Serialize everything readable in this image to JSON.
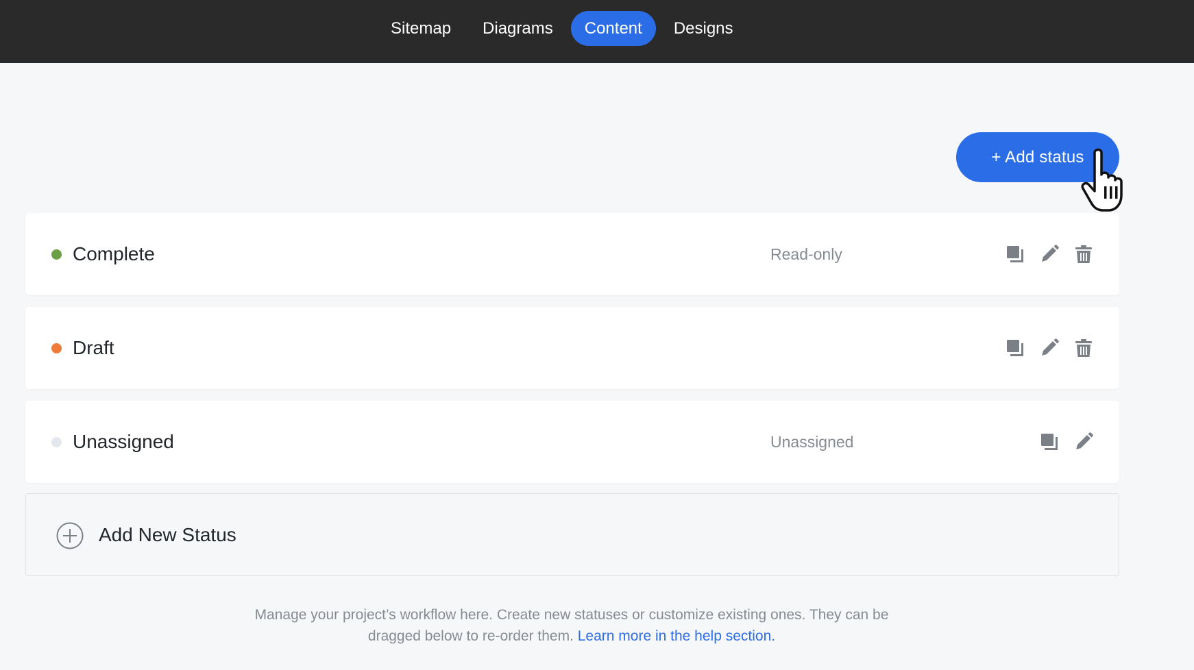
{
  "nav": {
    "tabs": [
      {
        "label": "Sitemap"
      },
      {
        "label": "Diagrams"
      },
      {
        "label": "Content"
      },
      {
        "label": "Designs"
      }
    ],
    "active_tab": "Content"
  },
  "toolbar": {
    "add_status_label": "+ Add status"
  },
  "statuses": [
    {
      "name": "Complete",
      "meta": "Read-only",
      "dot_color": "#6a9f45",
      "actions": [
        "duplicate-icon",
        "edit-icon",
        "delete-icon"
      ]
    },
    {
      "name": "Draft",
      "meta": "",
      "dot_color": "#f07a3a",
      "actions": [
        "duplicate-icon",
        "edit-icon",
        "delete-icon"
      ]
    },
    {
      "name": "Unassigned",
      "meta": "Unassigned",
      "dot_color": "#e3e7ee",
      "actions": [
        "duplicate-icon",
        "edit-icon"
      ]
    }
  ],
  "add_new": {
    "label": "Add New Status",
    "icon": "plus-circle-icon"
  },
  "help": {
    "line1": "Manage your project’s workflow here. Create new statuses or customize existing ones. They can be",
    "line2": "dragged below to re-order them.",
    "link": "Learn more in the help section."
  },
  "colors": {
    "topbar": "#2a2a2a",
    "accent": "#2b6de6",
    "background": "#f6f7f9"
  }
}
